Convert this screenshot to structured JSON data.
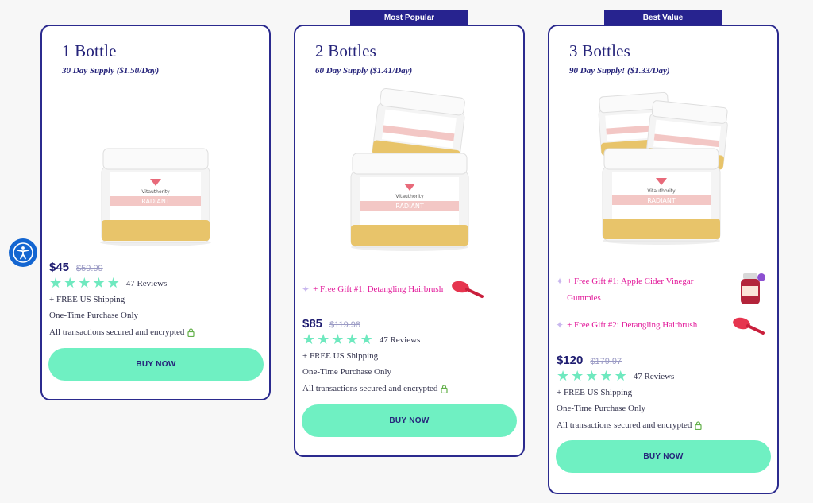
{
  "accessibility": {
    "label": "Accessibility"
  },
  "cards": [
    {
      "title": "1 Bottle",
      "supply": "30 Day Supply ($1.50/Day)",
      "price": "$45",
      "old_price": "$59.99",
      "reviews": "47 Reviews",
      "shipping": "+ FREE US Shipping",
      "purchase": "One-Time Purchase Only",
      "secure": "All transactions secured and encrypted",
      "button": "BUY NOW"
    },
    {
      "badge": "Most Popular",
      "title": "2 Bottles",
      "supply": "60 Day Supply ($1.41/Day)",
      "gifts": [
        "+ Free Gift #1: Detangling Hairbrush"
      ],
      "price": "$85",
      "old_price": "$119.98",
      "reviews": "47 Reviews",
      "shipping": "+ FREE US Shipping",
      "purchase": "One-Time Purchase Only",
      "secure": "All transactions secured and encrypted",
      "button": "BUY NOW"
    },
    {
      "badge": "Best Value",
      "title": "3 Bottles",
      "supply": "90 Day Supply! ($1.33/Day)",
      "gifts": [
        "+ Free Gift #1: Apple Cider Vinegar Gummies",
        "+ Free Gift #2: Detangling Hairbrush"
      ],
      "price": "$120",
      "old_price": "$179.97",
      "reviews": "47 Reviews",
      "shipping": "+ FREE US Shipping",
      "purchase": "One-Time Purchase Only",
      "secure": "All transactions secured and encrypted",
      "button": "BUY NOW"
    }
  ],
  "rating": 5,
  "product_label": {
    "brand": "Vitauthority",
    "name": "RADIANT"
  },
  "colors": {
    "navy": "#25237a",
    "mint": "#6ff0c2",
    "gift": "#e2199a",
    "a11y": "#1466d1"
  }
}
